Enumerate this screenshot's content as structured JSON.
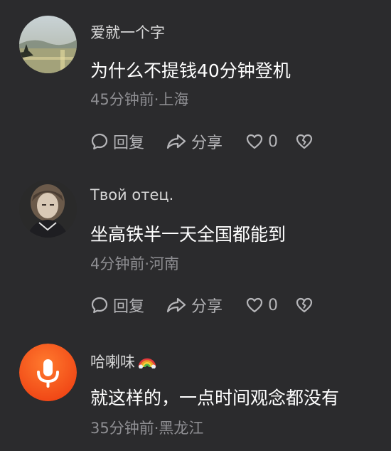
{
  "comments": [
    {
      "username": "爱就一个字",
      "text": "为什么不提钱40分钟登机",
      "meta": "45分钟前·上海",
      "reply_label": "回复",
      "share_label": "分享",
      "like_count": "0"
    },
    {
      "username": "Твой отец.",
      "text": "坐高铁半一天全国都能到",
      "meta": "4分钟前·河南",
      "reply_label": "回复",
      "share_label": "分享",
      "like_count": "0"
    },
    {
      "username": "哈喇味",
      "username_emoji": "rainbow-emoji",
      "text": "就这样的，一点时间观念都没有",
      "meta": "35分钟前·黑龙江"
    }
  ],
  "icons": {
    "reply": "reply-bubble-icon",
    "share": "share-arrow-icon",
    "like": "heart-icon",
    "dislike": "broken-heart-icon",
    "voice_avatar": "microphone-icon"
  },
  "colors": {
    "background": "#2b2b2d",
    "text_primary": "#ffffff",
    "text_secondary": "#8e8e92",
    "action": "#b5b5b8",
    "voice_avatar_orange": "#f25a1c"
  }
}
